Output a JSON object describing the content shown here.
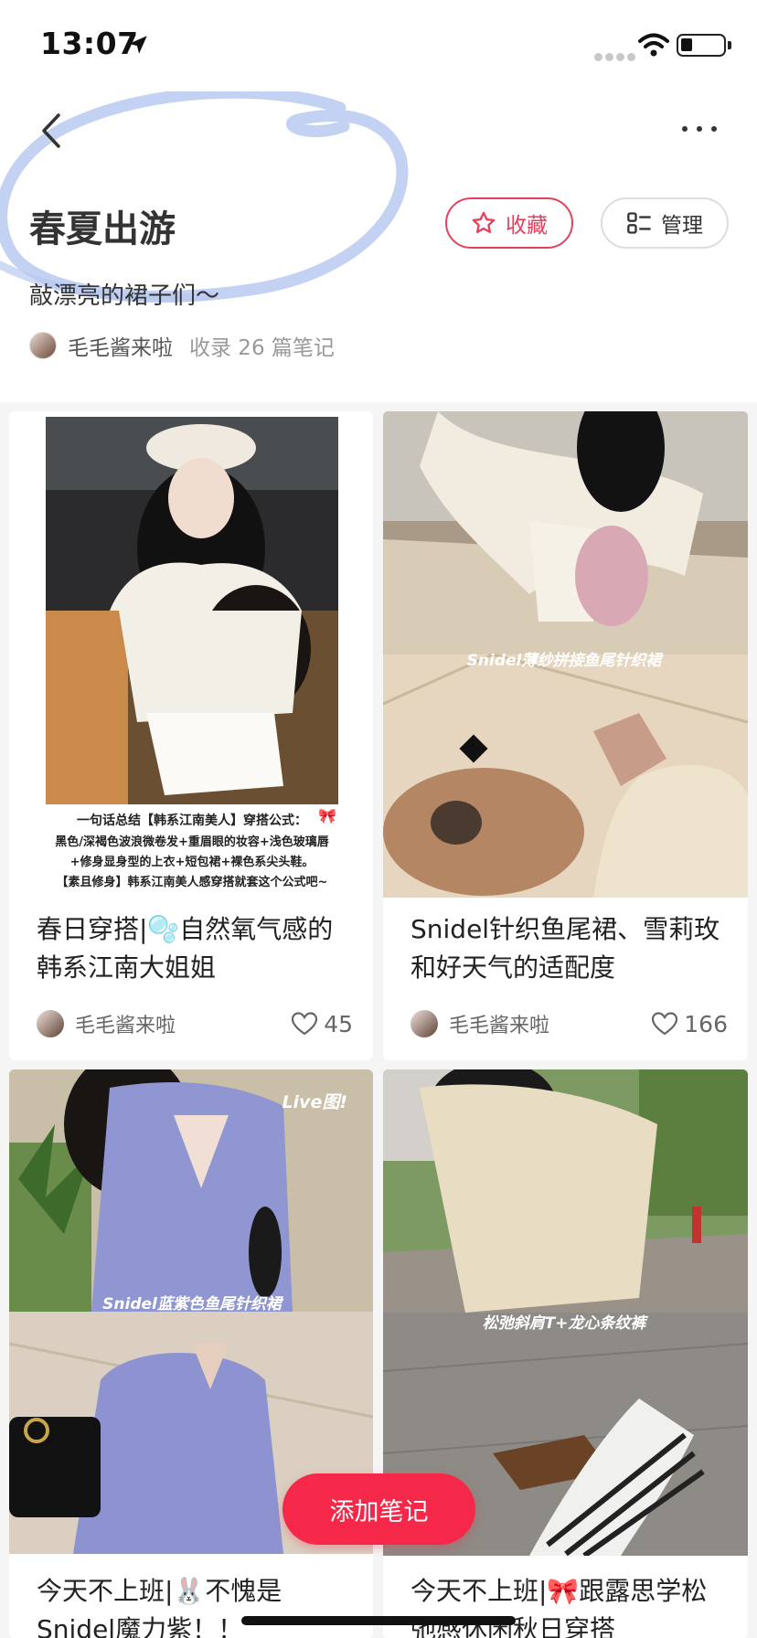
{
  "status_bar": {
    "time": "13:07"
  },
  "header": {
    "title": "春夏出游",
    "subtitle": "敲漂亮的裙子们～",
    "author": "毛毛酱来啦",
    "note_count": "收录 26 篇笔记",
    "favorite_label": "收藏",
    "manage_label": "管理"
  },
  "notes": [
    {
      "caption": "春日穿搭|🫧自然氧气感的韩系江南大姐姐",
      "author": "毛毛酱来啦",
      "likes": "45",
      "overlay": {
        "l1": "一句话总结【韩系江南美人】穿搭公式：",
        "l2": "黑色/深褐色波浪微卷发+重眉眼的妆容+浅色玻璃唇",
        "l3": "+修身显身型的上衣+短包裙+裸色系尖头鞋。",
        "l4": "【素且修身】韩系江南美人感穿搭就套这个公式吧~"
      }
    },
    {
      "caption": "Snidel针织鱼尾裙、雪莉玫和好天气的适配度",
      "author": "毛毛酱来啦",
      "likes": "166",
      "overlay": "Snidel薄纱拼接鱼尾针织裙"
    },
    {
      "caption": "今天不上班|🐰不愧是Snidel魔力紫！！",
      "overlay": "Snidel蓝紫色鱼尾针织裙",
      "badge": "Live图!"
    },
    {
      "caption": "今天不上班|🎀跟露思学松弛感休闲秋日穿搭",
      "overlay": "松弛斜肩T+龙心条纹裤"
    }
  ],
  "add_note_label": "添加笔记",
  "colors": {
    "accent": "#f5284a",
    "favorite": "#e4415c",
    "scribble": "#b9c9f0"
  }
}
